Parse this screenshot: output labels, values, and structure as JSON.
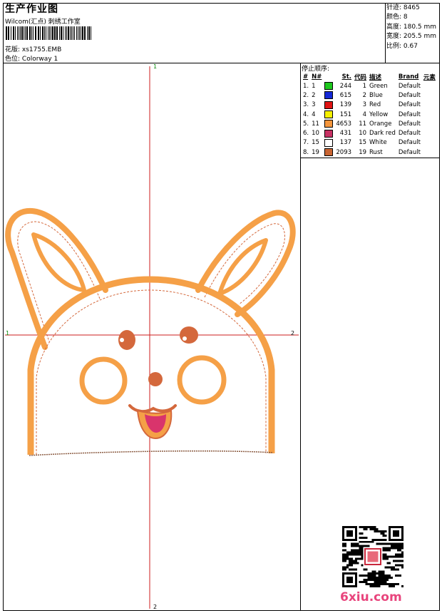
{
  "header": {
    "title": "生产作业图",
    "company": "Wilcom(汇点) 刺绣工作室",
    "design_label": "花版:",
    "design_value": "xs1755.EMB",
    "colorway_label": "色位:",
    "colorway_value": "Colorway 1"
  },
  "stats": {
    "stitches": "针迹: 8465",
    "colors": "颜色: 8",
    "height": "高度: 180.5 mm",
    "width": "宽度: 205.5 mm",
    "scale": "比例: 0.67"
  },
  "stop_sequence": {
    "title": "停止顺序:",
    "headers": [
      "#",
      "N#",
      "St.",
      "代码",
      "描述",
      "Brand",
      "元素"
    ],
    "rows": [
      {
        "idx": "1.",
        "n": "1",
        "color": "#1ec81e",
        "st": "244",
        "code": "1",
        "desc": "Green",
        "brand": "Default"
      },
      {
        "idx": "2.",
        "n": "2",
        "color": "#1428d6",
        "st": "615",
        "code": "2",
        "desc": "Blue",
        "brand": "Default"
      },
      {
        "idx": "3.",
        "n": "3",
        "color": "#e01414",
        "st": "139",
        "code": "3",
        "desc": "Red",
        "brand": "Default"
      },
      {
        "idx": "4.",
        "n": "4",
        "color": "#f5f000",
        "st": "151",
        "code": "4",
        "desc": "Yellow",
        "brand": "Default"
      },
      {
        "idx": "5.",
        "n": "11",
        "color": "#f5963c",
        "st": "4653",
        "code": "11",
        "desc": "Orange",
        "brand": "Default"
      },
      {
        "idx": "6.",
        "n": "10",
        "color": "#c83264",
        "st": "431",
        "code": "10",
        "desc": "Dark red",
        "brand": "Default"
      },
      {
        "idx": "7.",
        "n": "15",
        "color": "#ffffff",
        "st": "137",
        "code": "15",
        "desc": "White",
        "brand": "Default"
      },
      {
        "idx": "8.",
        "n": "19",
        "color": "#c86432",
        "st": "2093",
        "code": "19",
        "desc": "Rust",
        "brand": "Default"
      }
    ]
  },
  "axes": {
    "top": "1",
    "bottom": "2",
    "left": "1",
    "right": "2"
  },
  "colors": {
    "orange": "#f5a047",
    "rust": "#d4683c",
    "crosshair": "#cc1c1c",
    "tongue": "#d9346c"
  },
  "watermark": "6xiu.com"
}
